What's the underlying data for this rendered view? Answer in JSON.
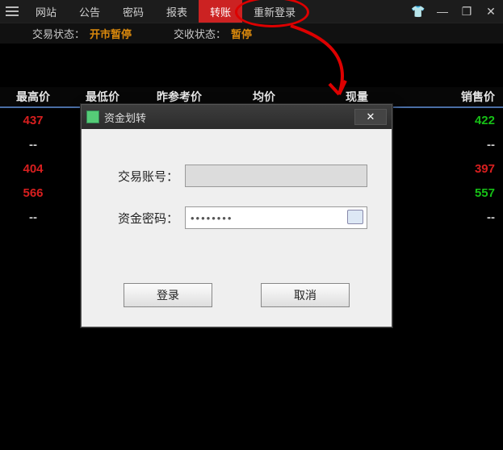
{
  "menu": {
    "items": [
      "网站",
      "公告",
      "密码",
      "报表",
      "转账",
      "重新登录"
    ],
    "active_index": 4
  },
  "status": {
    "trade_label": "交易状态：",
    "trade_value": "开市暂停",
    "deliver_label": "交收状态：",
    "deliver_value": "暂停"
  },
  "table": {
    "headers": [
      "最高价",
      "最低价",
      "昨参考价",
      "均价",
      "现量",
      "销售价"
    ],
    "rows": [
      {
        "c1": "437",
        "c1c": "red",
        "c2": "--",
        "c2c": "dash",
        "c6": "422",
        "c6c": "green"
      },
      {
        "c1": "--",
        "c1c": "dash",
        "c2": "--",
        "c2c": "dash",
        "c6": "--",
        "c6c": "dash"
      },
      {
        "c1": "404",
        "c1c": "red",
        "c2": "--",
        "c2c": "dash",
        "c6": "397",
        "c6c": "red"
      },
      {
        "c1": "566",
        "c1c": "red",
        "c2": "--",
        "c2c": "dash",
        "c6": "557",
        "c6c": "green"
      },
      {
        "c1": "--",
        "c1c": "dash",
        "c2": "--",
        "c2c": "dash",
        "c6": "--",
        "c6c": "dash"
      }
    ]
  },
  "modal": {
    "title": "资金划转",
    "account_label": "交易账号：",
    "account_value": "",
    "password_label": "资金密码：",
    "password_value": "••••••••",
    "login_btn": "登录",
    "cancel_btn": "取消"
  }
}
